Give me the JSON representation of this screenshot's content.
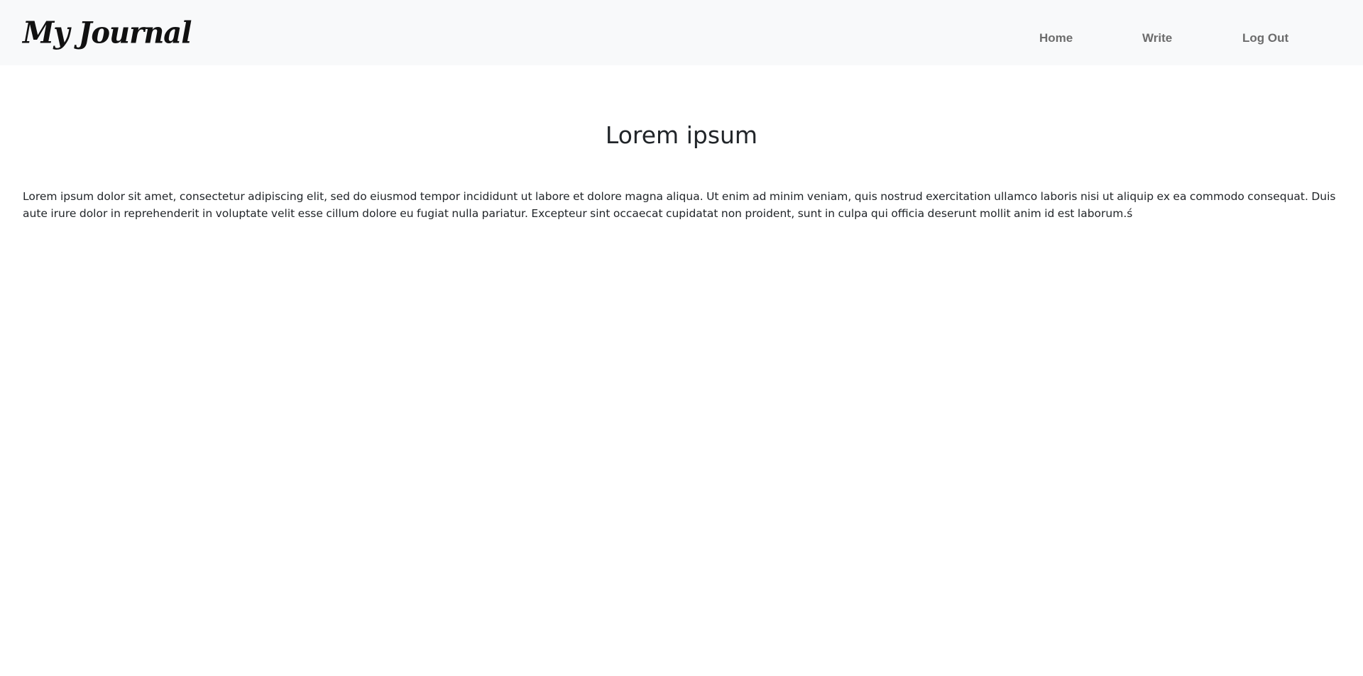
{
  "navbar": {
    "brand": "My Journal",
    "links": [
      {
        "label": "Home"
      },
      {
        "label": "Write"
      },
      {
        "label": "Log Out"
      }
    ]
  },
  "post": {
    "title": "Lorem ipsum",
    "body": "Lorem ipsum dolor sit amet, consectetur adipiscing elit, sed do eiusmod tempor incididunt ut labore et dolore magna aliqua. Ut enim ad minim veniam, quis nostrud exercitation ullamco laboris nisi ut aliquip ex ea commodo consequat. Duis aute irure dolor in reprehenderit in voluptate velit esse cillum dolore eu fugiat nulla pariatur. Excepteur sint occaecat cupidatat non proident, sunt in culpa qui officia deserunt mollit anim id est laborum.ś"
  },
  "colors": {
    "navbar_background": "#f8f9fa",
    "brand_text": "#111111",
    "nav_link": "#6c6c6c",
    "body_text": "#212529",
    "page_background": "#ffffff"
  }
}
